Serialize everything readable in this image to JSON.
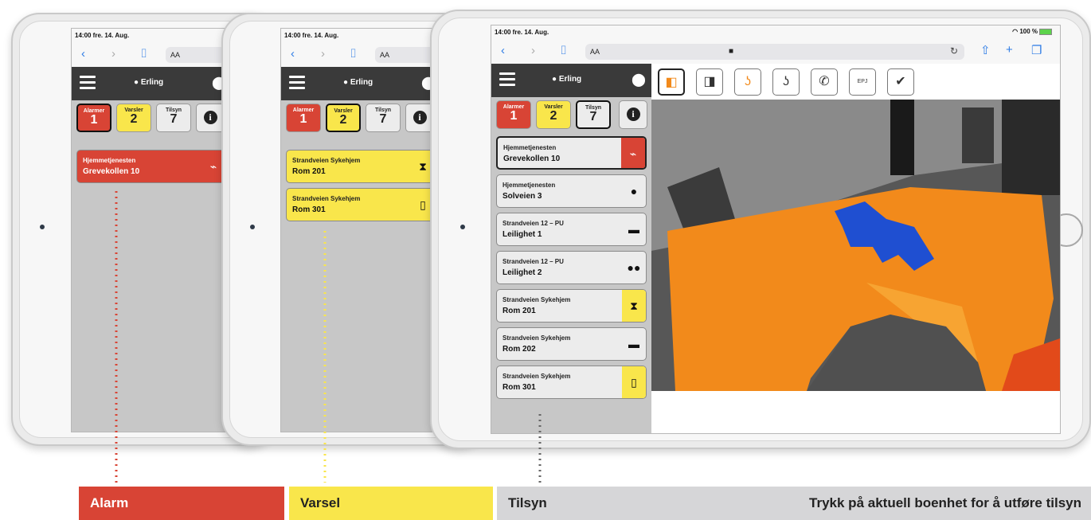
{
  "status": {
    "time": "14:00  fre. 14. Aug.",
    "battery": "100 %"
  },
  "browser": {
    "aa": "AA",
    "back": "‹",
    "forward": "›",
    "bookmarks": "⌷"
  },
  "header": {
    "user": "Erling"
  },
  "counters": {
    "alarm": {
      "label": "Alarmer",
      "count": "1"
    },
    "varsel": {
      "label": "Varsler",
      "count": "2"
    },
    "tilsyn": {
      "label": "Tilsyn",
      "count": "7"
    }
  },
  "tablet1": {
    "cards": [
      {
        "line1": "Hjemmetjenesten",
        "line2": "Grevekollen 10",
        "icon": "fall-icon"
      }
    ]
  },
  "tablet2": {
    "cards": [
      {
        "line1": "Strandveien Sykehjem",
        "line2": "Rom 201",
        "icon": "hourglass-alert-icon"
      },
      {
        "line1": "Strandveien Sykehjem",
        "line2": "Rom 301",
        "icon": "door-exit-icon"
      }
    ]
  },
  "tablet3": {
    "cards": [
      {
        "line1": "Hjemmetjenesten",
        "line2": "Grevekollen 10",
        "icon": "fall-icon"
      },
      {
        "line1": "Hjemmetjenesten",
        "line2": "Solveien 3",
        "icon": "person-icon"
      },
      {
        "line1": "Strandveien 12 – PU",
        "line2": "Leilighet 1",
        "icon": "bed-icon"
      },
      {
        "line1": "Strandveien 12 – PU",
        "line2": "Leilighet 2",
        "icon": "two-persons-icon"
      },
      {
        "line1": "Strandveien Sykehjem",
        "line2": "Rom 201",
        "icon": "hourglass-alert-icon"
      },
      {
        "line1": "Strandveien Sykehjem",
        "line2": "Rom 202",
        "icon": "bed-icon"
      },
      {
        "line1": "Strandveien Sykehjem",
        "line2": "Rom 301",
        "icon": "door-exit-icon"
      }
    ],
    "toolbar_icons": [
      "camera-view-icon",
      "camera-view-alt-icon",
      "listen-orange-icon",
      "listen-icon",
      "phone-icon",
      "epj-icon",
      "check-icon"
    ],
    "epj_label": "EPJ"
  },
  "legend": {
    "alarm": "Alarm",
    "varsel": "Varsel",
    "tilsyn": "Tilsyn",
    "hint": "Trykk på aktuell boenhet for å utføre tilsyn"
  },
  "colors": {
    "alarm": "#d84435",
    "varsel": "#f9e64b",
    "tilsyn": "#d6d6d8",
    "header": "#3a3a3a",
    "thermal": "#f28a1b",
    "person": "#1f4fd1"
  }
}
